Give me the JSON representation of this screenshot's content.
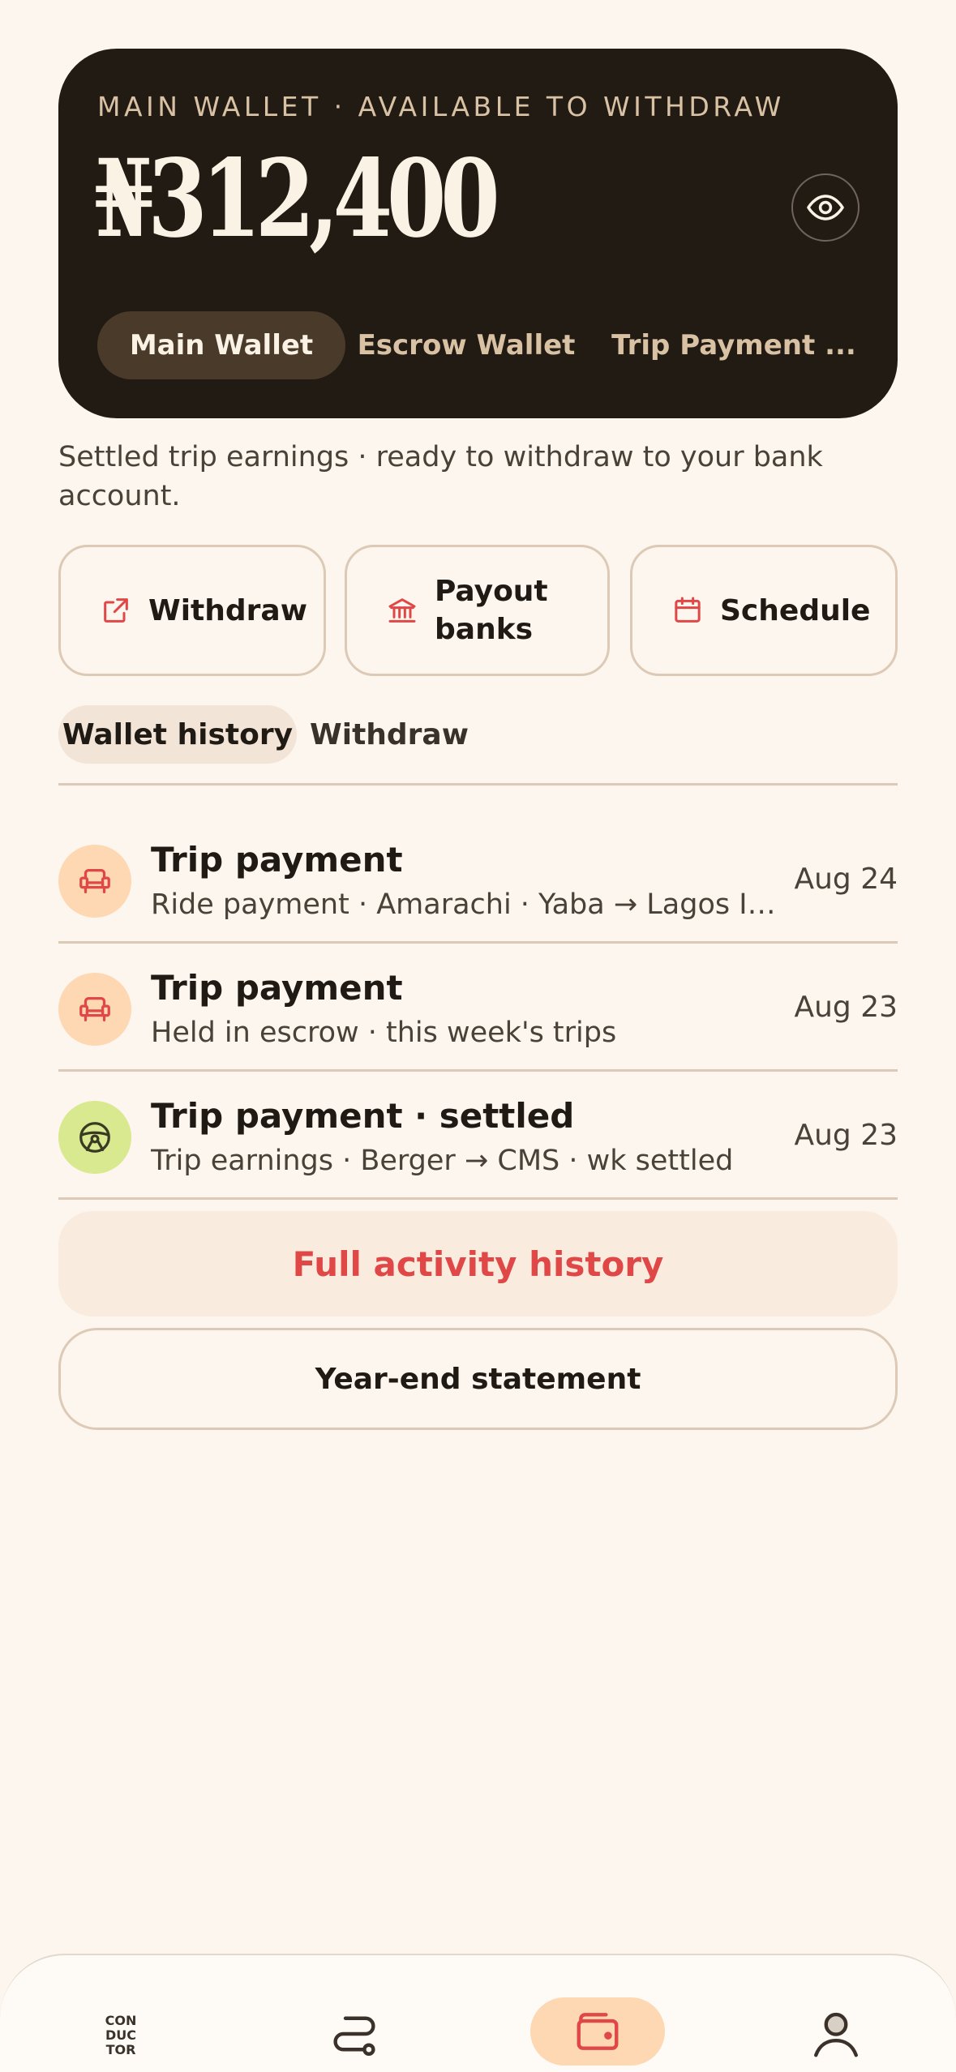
{
  "wallet": {
    "eyebrow": "MAIN WALLET · AVAILABLE TO WITHDRAW",
    "balance": "₦312,400",
    "tabs": [
      {
        "label": "Main Wallet",
        "active": true
      },
      {
        "label": "Escrow Wallet",
        "active": false
      },
      {
        "label": "Trip Payment ...",
        "active": false
      }
    ]
  },
  "subtitle": "Settled trip earnings · ready to withdraw to your bank account.",
  "actions": [
    {
      "label": "Withdraw",
      "icon": "external-link-icon"
    },
    {
      "label": "Payout banks",
      "icon": "bank-icon"
    },
    {
      "label": "Schedule",
      "icon": "calendar-icon"
    }
  ],
  "history_tabs": [
    {
      "label": "Wallet history",
      "active": true
    },
    {
      "label": "Withdraw",
      "active": false
    }
  ],
  "transactions": [
    {
      "title": "Trip payment",
      "description": "Ride payment · Amarachi · Yaba → Lagos Isl...",
      "date": "Aug 24",
      "icon": "seat-icon"
    },
    {
      "title": "Trip payment",
      "description": "Held in escrow · this week's trips",
      "date": "Aug 23",
      "icon": "seat-icon"
    },
    {
      "title": "Trip payment · settled",
      "description": "Trip earnings · Berger → CMS · wk settled",
      "date": "Aug 23",
      "icon": "steering-wheel-icon"
    }
  ],
  "buttons": {
    "full_history": "Full activity history",
    "year_end": "Year-end statement"
  },
  "nav": {
    "logo_text": [
      "CON",
      "DUC",
      "TOR"
    ],
    "items": [
      "logo-icon",
      "route-icon",
      "wallet-icon",
      "profile-icon"
    ],
    "active": "wallet-icon"
  },
  "colors": {
    "background": "#fdf6ee",
    "card": "#211b14",
    "accent": "#e04848",
    "pill_orange": "#fdd8b2",
    "pill_green": "#d8e98f"
  }
}
